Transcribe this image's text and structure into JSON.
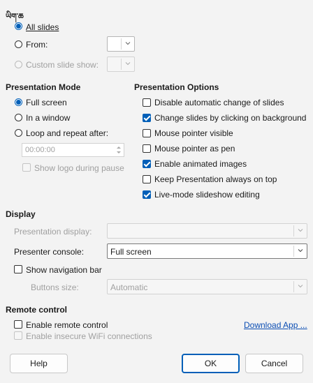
{
  "range": {
    "heading": "ཡིག་ཆ",
    "all_slides": "All slides",
    "from": "From:",
    "custom_slide_show": "Custom slide show:"
  },
  "presentation_mode": {
    "heading": "Presentation Mode",
    "full_screen": "Full screen",
    "in_window": "In a window",
    "loop": "Loop and repeat after:",
    "loop_time": "00:00:00",
    "show_logo": "Show logo during pause"
  },
  "presentation_options": {
    "heading": "Presentation Options",
    "items": [
      {
        "label": "Disable automatic change of slides",
        "checked": false
      },
      {
        "label": "Change slides by clicking on background",
        "checked": true
      },
      {
        "label": "Mouse pointer visible",
        "checked": false
      },
      {
        "label": "Mouse pointer as pen",
        "checked": false
      },
      {
        "label": "Enable animated images",
        "checked": true
      },
      {
        "label": "Keep Presentation always on top",
        "checked": false
      },
      {
        "label": "Live-mode slideshow editing",
        "checked": true
      }
    ]
  },
  "display": {
    "heading": "Display",
    "presentation_display_label": "Presentation display:",
    "presentation_display_value": "",
    "presenter_console_label": "Presenter console:",
    "presenter_console_value": "Full screen",
    "show_nav_bar": "Show navigation bar",
    "buttons_size_label": "Buttons size:",
    "buttons_size_value": "Automatic"
  },
  "remote": {
    "heading": "Remote control",
    "enable_remote": "Enable remote control",
    "download_app": "Download App ...",
    "enable_insecure": "Enable insecure WiFi connections"
  },
  "buttons": {
    "help": "Help",
    "ok": "OK",
    "cancel": "Cancel"
  },
  "colors": {
    "accent": "#005fb8",
    "background": "#f3f3f3",
    "link": "#0b4db3"
  }
}
